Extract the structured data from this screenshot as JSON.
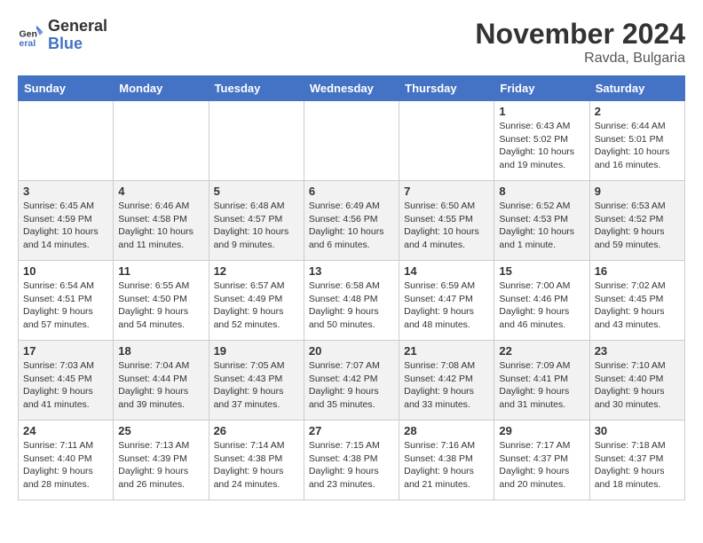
{
  "logo": {
    "general": "General",
    "blue": "Blue"
  },
  "header": {
    "month": "November 2024",
    "location": "Ravda, Bulgaria"
  },
  "weekdays": [
    "Sunday",
    "Monday",
    "Tuesday",
    "Wednesday",
    "Thursday",
    "Friday",
    "Saturday"
  ],
  "weeks": [
    [
      {
        "day": "",
        "info": ""
      },
      {
        "day": "",
        "info": ""
      },
      {
        "day": "",
        "info": ""
      },
      {
        "day": "",
        "info": ""
      },
      {
        "day": "",
        "info": ""
      },
      {
        "day": "1",
        "info": "Sunrise: 6:43 AM\nSunset: 5:02 PM\nDaylight: 10 hours\nand 19 minutes."
      },
      {
        "day": "2",
        "info": "Sunrise: 6:44 AM\nSunset: 5:01 PM\nDaylight: 10 hours\nand 16 minutes."
      }
    ],
    [
      {
        "day": "3",
        "info": "Sunrise: 6:45 AM\nSunset: 4:59 PM\nDaylight: 10 hours\nand 14 minutes."
      },
      {
        "day": "4",
        "info": "Sunrise: 6:46 AM\nSunset: 4:58 PM\nDaylight: 10 hours\nand 11 minutes."
      },
      {
        "day": "5",
        "info": "Sunrise: 6:48 AM\nSunset: 4:57 PM\nDaylight: 10 hours\nand 9 minutes."
      },
      {
        "day": "6",
        "info": "Sunrise: 6:49 AM\nSunset: 4:56 PM\nDaylight: 10 hours\nand 6 minutes."
      },
      {
        "day": "7",
        "info": "Sunrise: 6:50 AM\nSunset: 4:55 PM\nDaylight: 10 hours\nand 4 minutes."
      },
      {
        "day": "8",
        "info": "Sunrise: 6:52 AM\nSunset: 4:53 PM\nDaylight: 10 hours\nand 1 minute."
      },
      {
        "day": "9",
        "info": "Sunrise: 6:53 AM\nSunset: 4:52 PM\nDaylight: 9 hours\nand 59 minutes."
      }
    ],
    [
      {
        "day": "10",
        "info": "Sunrise: 6:54 AM\nSunset: 4:51 PM\nDaylight: 9 hours\nand 57 minutes."
      },
      {
        "day": "11",
        "info": "Sunrise: 6:55 AM\nSunset: 4:50 PM\nDaylight: 9 hours\nand 54 minutes."
      },
      {
        "day": "12",
        "info": "Sunrise: 6:57 AM\nSunset: 4:49 PM\nDaylight: 9 hours\nand 52 minutes."
      },
      {
        "day": "13",
        "info": "Sunrise: 6:58 AM\nSunset: 4:48 PM\nDaylight: 9 hours\nand 50 minutes."
      },
      {
        "day": "14",
        "info": "Sunrise: 6:59 AM\nSunset: 4:47 PM\nDaylight: 9 hours\nand 48 minutes."
      },
      {
        "day": "15",
        "info": "Sunrise: 7:00 AM\nSunset: 4:46 PM\nDaylight: 9 hours\nand 46 minutes."
      },
      {
        "day": "16",
        "info": "Sunrise: 7:02 AM\nSunset: 4:45 PM\nDaylight: 9 hours\nand 43 minutes."
      }
    ],
    [
      {
        "day": "17",
        "info": "Sunrise: 7:03 AM\nSunset: 4:45 PM\nDaylight: 9 hours\nand 41 minutes."
      },
      {
        "day": "18",
        "info": "Sunrise: 7:04 AM\nSunset: 4:44 PM\nDaylight: 9 hours\nand 39 minutes."
      },
      {
        "day": "19",
        "info": "Sunrise: 7:05 AM\nSunset: 4:43 PM\nDaylight: 9 hours\nand 37 minutes."
      },
      {
        "day": "20",
        "info": "Sunrise: 7:07 AM\nSunset: 4:42 PM\nDaylight: 9 hours\nand 35 minutes."
      },
      {
        "day": "21",
        "info": "Sunrise: 7:08 AM\nSunset: 4:42 PM\nDaylight: 9 hours\nand 33 minutes."
      },
      {
        "day": "22",
        "info": "Sunrise: 7:09 AM\nSunset: 4:41 PM\nDaylight: 9 hours\nand 31 minutes."
      },
      {
        "day": "23",
        "info": "Sunrise: 7:10 AM\nSunset: 4:40 PM\nDaylight: 9 hours\nand 30 minutes."
      }
    ],
    [
      {
        "day": "24",
        "info": "Sunrise: 7:11 AM\nSunset: 4:40 PM\nDaylight: 9 hours\nand 28 minutes."
      },
      {
        "day": "25",
        "info": "Sunrise: 7:13 AM\nSunset: 4:39 PM\nDaylight: 9 hours\nand 26 minutes."
      },
      {
        "day": "26",
        "info": "Sunrise: 7:14 AM\nSunset: 4:38 PM\nDaylight: 9 hours\nand 24 minutes."
      },
      {
        "day": "27",
        "info": "Sunrise: 7:15 AM\nSunset: 4:38 PM\nDaylight: 9 hours\nand 23 minutes."
      },
      {
        "day": "28",
        "info": "Sunrise: 7:16 AM\nSunset: 4:38 PM\nDaylight: 9 hours\nand 21 minutes."
      },
      {
        "day": "29",
        "info": "Sunrise: 7:17 AM\nSunset: 4:37 PM\nDaylight: 9 hours\nand 20 minutes."
      },
      {
        "day": "30",
        "info": "Sunrise: 7:18 AM\nSunset: 4:37 PM\nDaylight: 9 hours\nand 18 minutes."
      }
    ]
  ]
}
